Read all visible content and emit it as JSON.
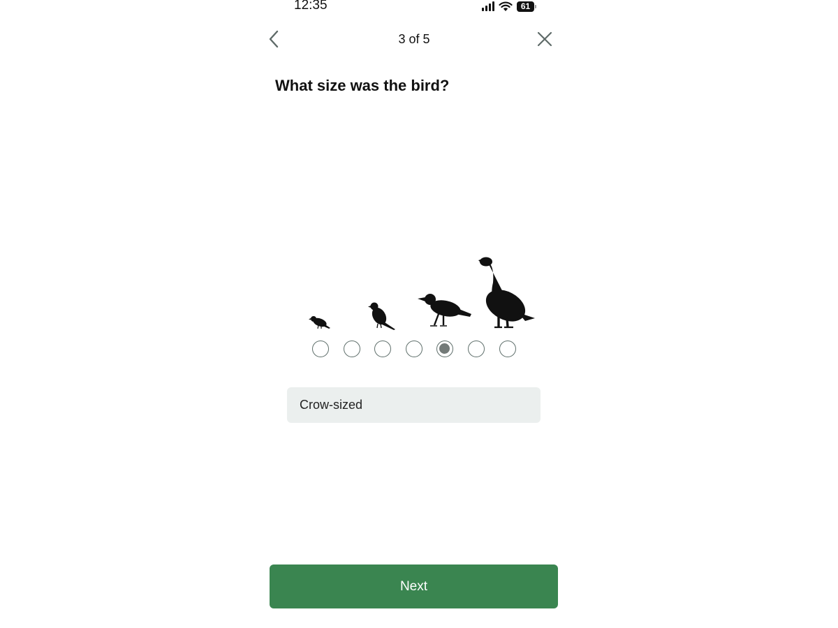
{
  "status_bar": {
    "time": "12:35",
    "battery_level": "61",
    "signal_icon": "cellular-signal-icon",
    "wifi_icon": "wifi-icon"
  },
  "nav": {
    "back_icon": "chevron-left-icon",
    "close_icon": "close-icon",
    "progress_label": "3 of 5"
  },
  "question": {
    "title": "What size was the bird?"
  },
  "size_selector": {
    "option_count": 7,
    "selected_index": 4,
    "bird_icons": [
      "sparrow-silhouette-icon",
      "robin-silhouette-icon",
      "crow-silhouette-icon",
      "goose-silhouette-icon"
    ],
    "selected_label": "Crow-sized"
  },
  "actions": {
    "next_label": "Next"
  },
  "colors": {
    "primary_button": "#3a8550",
    "answer_background": "#ebefee",
    "radio_border": "#5f6f6b",
    "radio_fill": "#737a78"
  }
}
